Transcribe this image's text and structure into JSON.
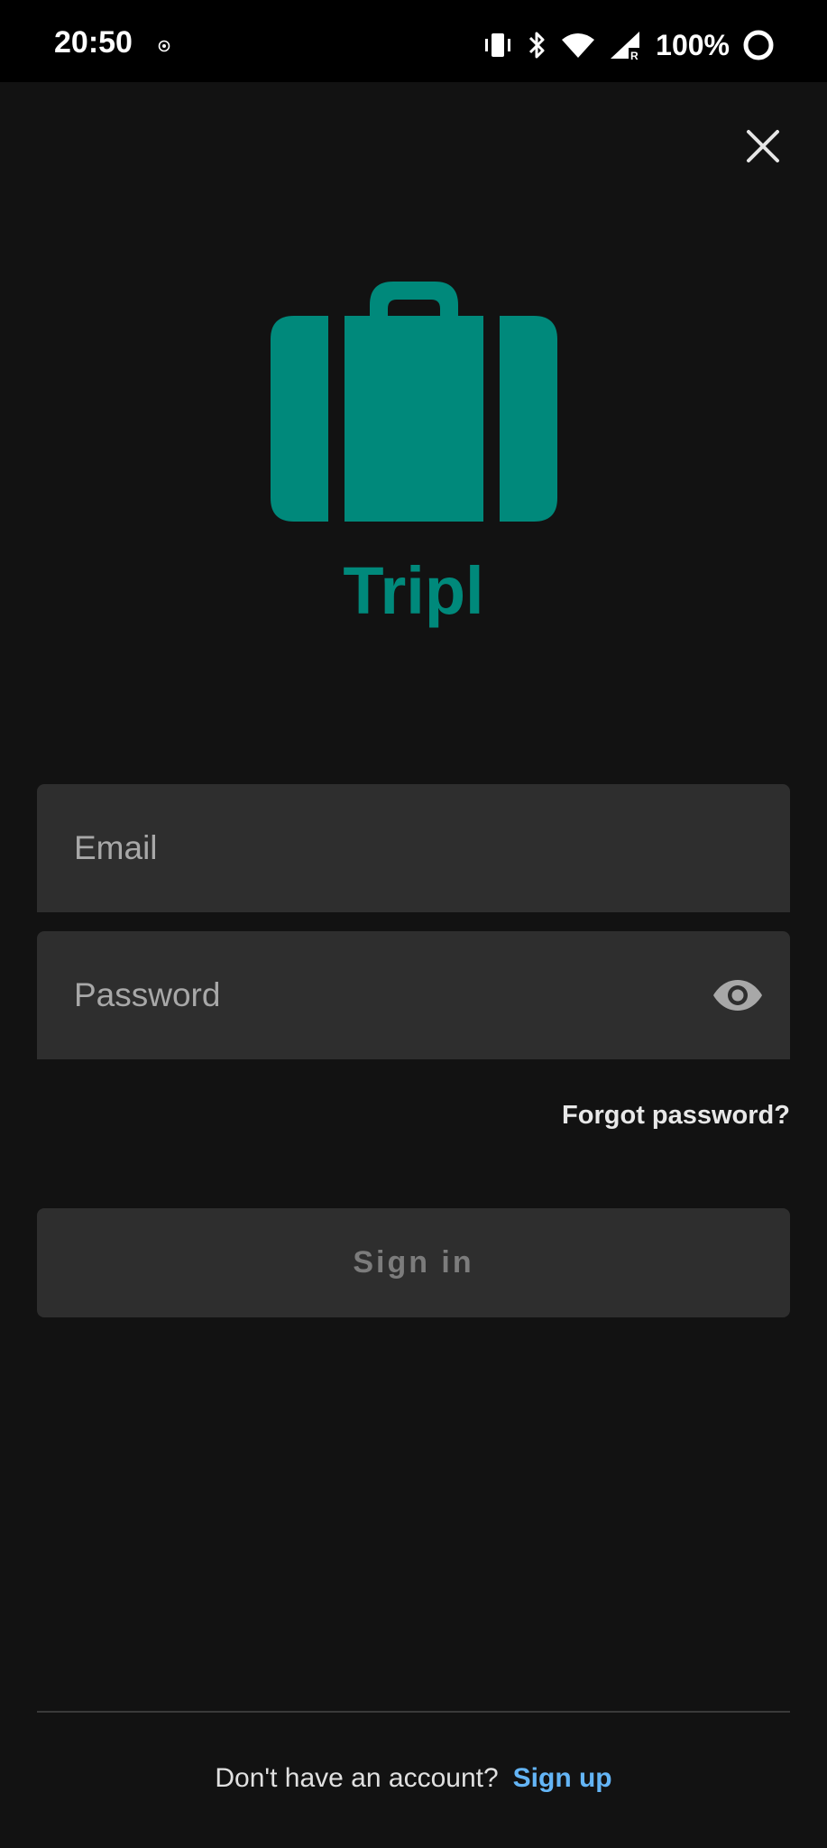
{
  "status_bar": {
    "time": "20:50",
    "notification_icon": "whatsapp-icon",
    "icons": [
      "vibrate-icon",
      "bluetooth-icon",
      "wifi-icon",
      "signal-icon"
    ],
    "battery_percent": "100%",
    "battery_icon": "battery-ring-icon"
  },
  "header": {
    "close_icon": "close-icon"
  },
  "logo": {
    "icon": "suitcase-icon",
    "app_name": "Tripl",
    "brand_color": "#00897b"
  },
  "form": {
    "email": {
      "placeholder": "Email",
      "value": ""
    },
    "password": {
      "placeholder": "Password",
      "value": "",
      "toggle_icon": "eye-icon"
    },
    "forgot_password": "Forgot password?",
    "sign_in_label": "Sign in"
  },
  "footer": {
    "prompt": "Don't have an account?",
    "sign_up_label": "Sign up",
    "link_color": "#64b5f6"
  }
}
